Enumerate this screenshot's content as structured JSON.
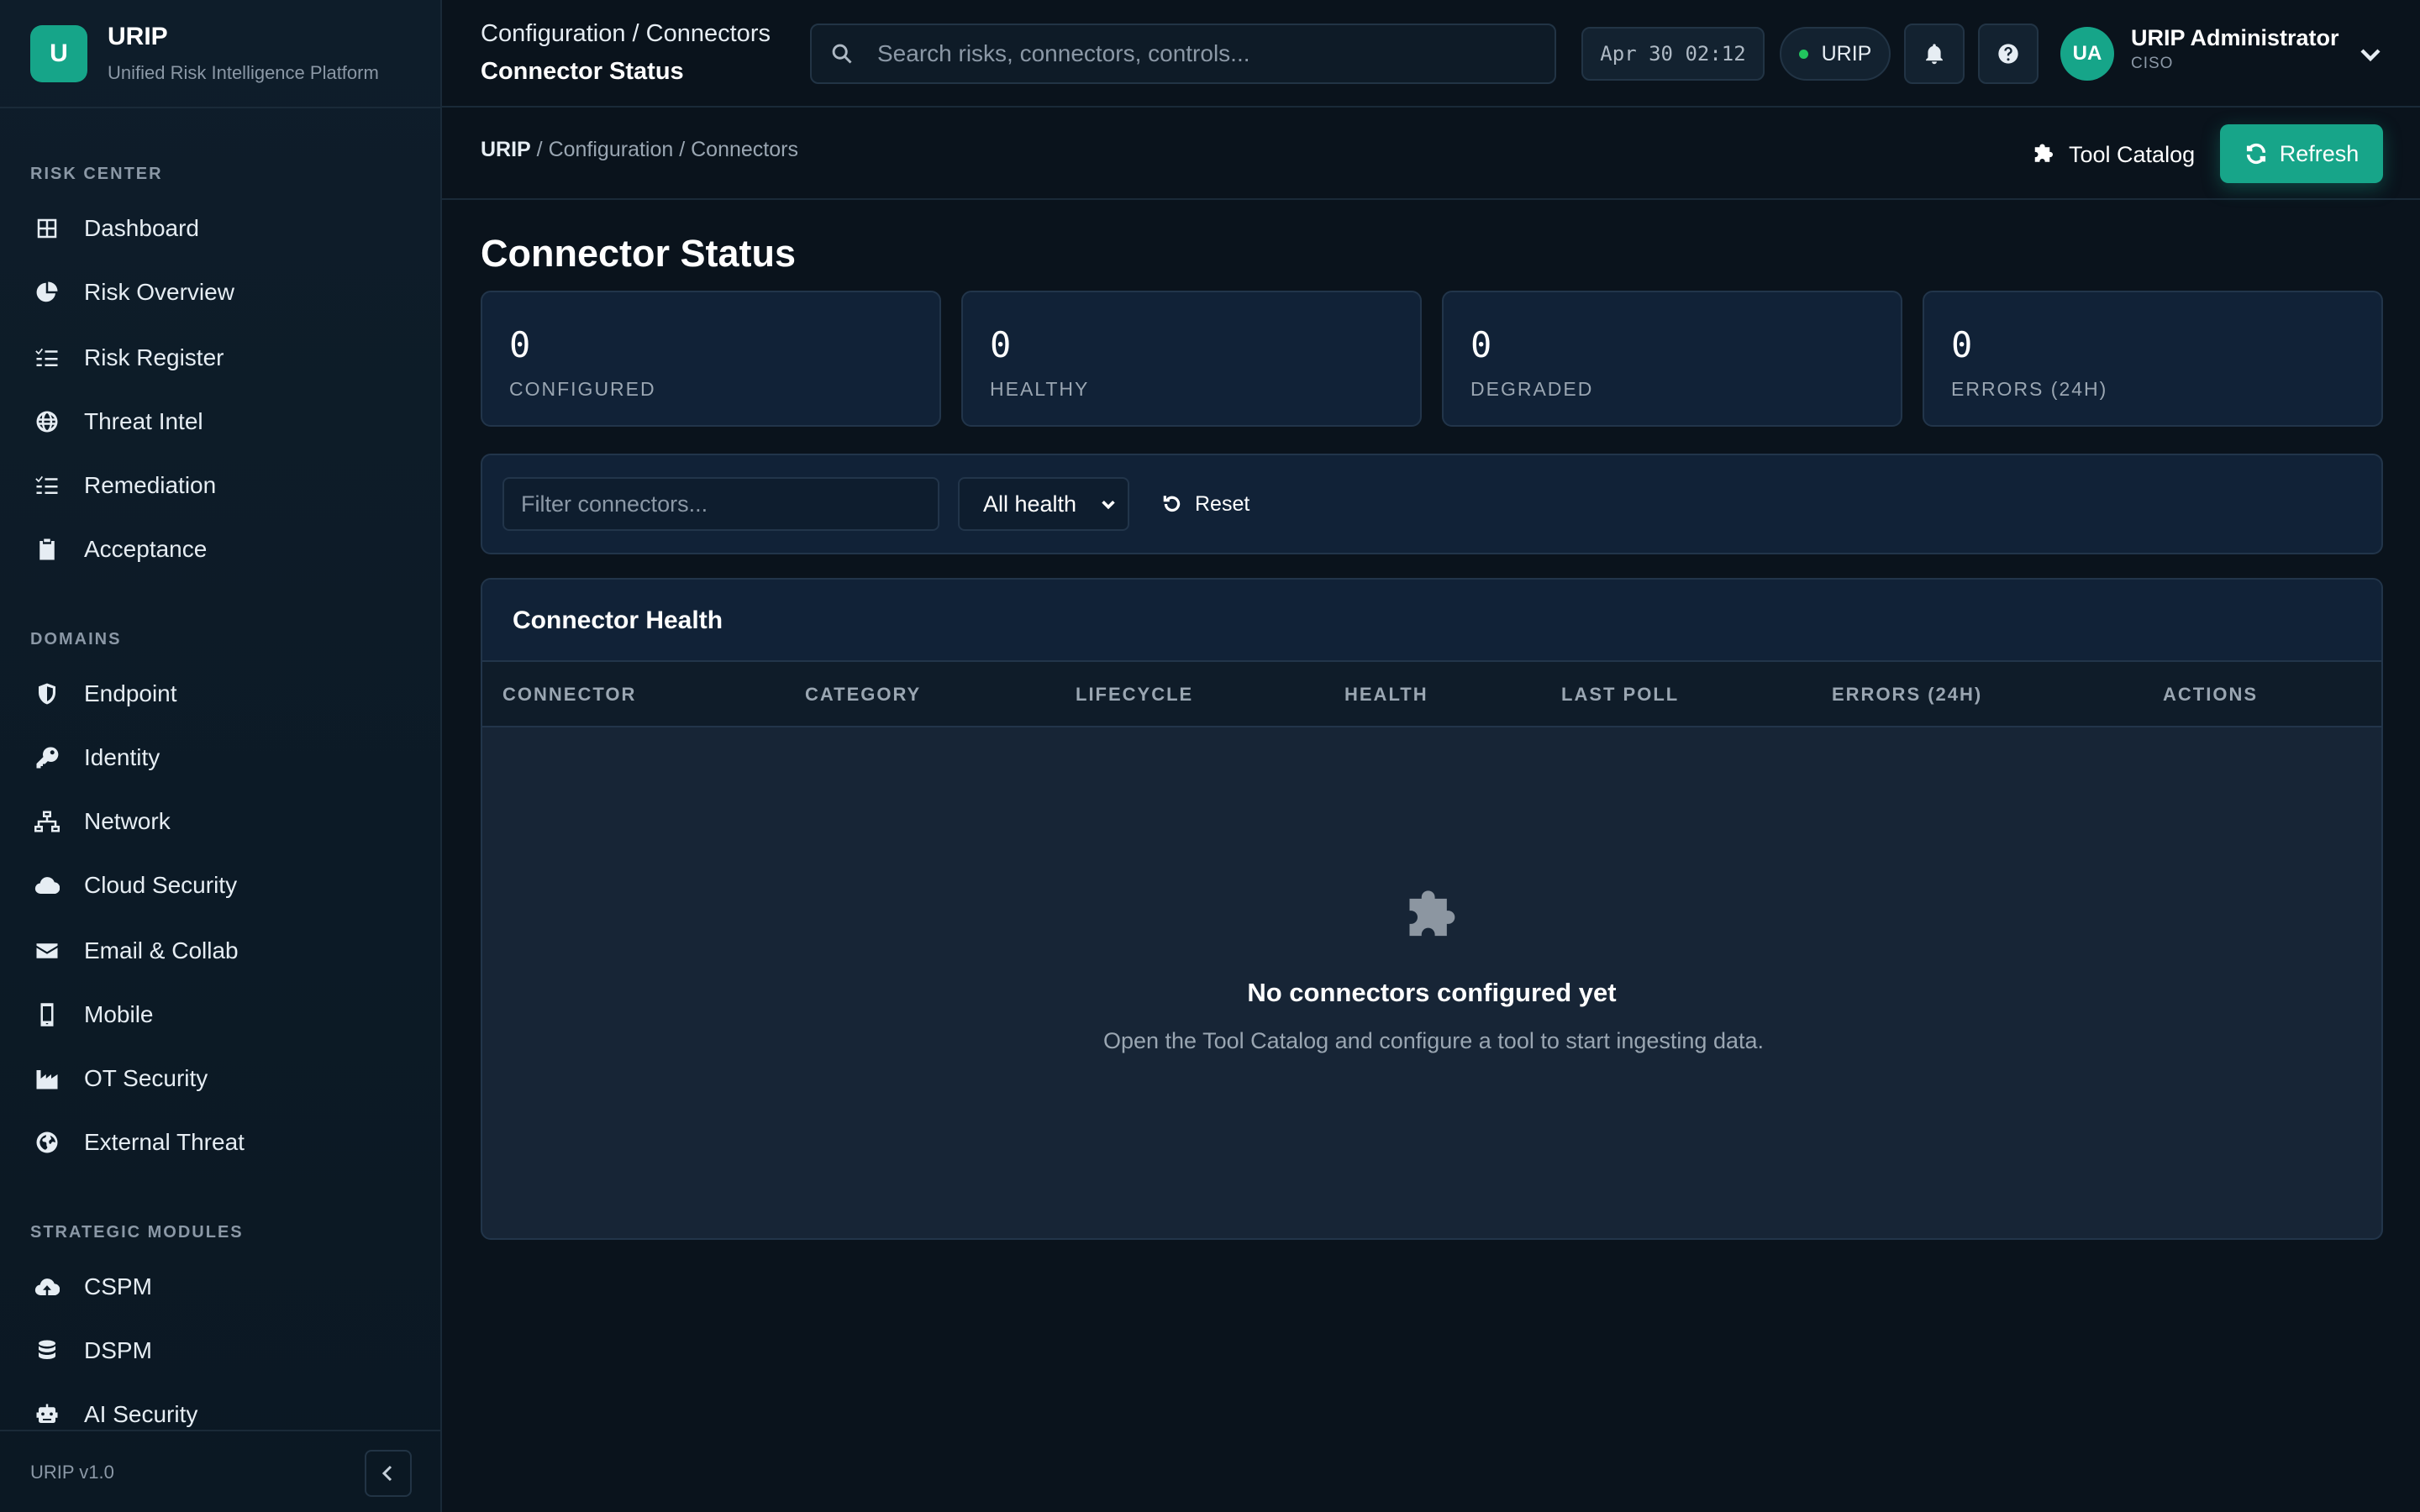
{
  "brand": {
    "logo_letter": "U",
    "name": "URIP",
    "subtitle": "Unified Risk Intelligence Platform"
  },
  "sidebar": {
    "sections": [
      {
        "label": "RISK CENTER",
        "items": [
          {
            "label": "Dashboard",
            "icon": "grid-icon"
          },
          {
            "label": "Risk Overview",
            "icon": "pie-chart-icon"
          },
          {
            "label": "Risk Register",
            "icon": "list-check-icon"
          },
          {
            "label": "Threat Intel",
            "icon": "globe-icon"
          },
          {
            "label": "Remediation",
            "icon": "list-check-icon"
          },
          {
            "label": "Acceptance",
            "icon": "clipboard-check-icon"
          }
        ]
      },
      {
        "label": "DOMAINS",
        "items": [
          {
            "label": "Endpoint",
            "icon": "shield-icon"
          },
          {
            "label": "Identity",
            "icon": "key-icon"
          },
          {
            "label": "Network",
            "icon": "network-icon"
          },
          {
            "label": "Cloud Security",
            "icon": "cloud-icon"
          },
          {
            "label": "Email & Collab",
            "icon": "envelope-icon"
          },
          {
            "label": "Mobile",
            "icon": "mobile-icon"
          },
          {
            "label": "OT Security",
            "icon": "industry-icon"
          },
          {
            "label": "External Threat",
            "icon": "globe-alt-icon"
          }
        ]
      },
      {
        "label": "STRATEGIC MODULES",
        "items": [
          {
            "label": "CSPM",
            "icon": "cloud-upload-icon"
          },
          {
            "label": "DSPM",
            "icon": "database-icon"
          },
          {
            "label": "AI Security",
            "icon": "robot-icon"
          }
        ]
      }
    ],
    "version": "URIP v1.0"
  },
  "topbar": {
    "path": "Configuration / Connectors",
    "page": "Connector Status",
    "search_placeholder": "Search risks, connectors, controls...",
    "clock": "Apr 30 02:12",
    "tenant": "URIP",
    "user": {
      "initials": "UA",
      "name": "URIP Administrator",
      "role": "CISO"
    }
  },
  "subheader": {
    "breadcrumb_root": "URIP",
    "breadcrumb_rest": " / Configuration / Connectors",
    "tool_catalog_label": "Tool Catalog",
    "refresh_label": "Refresh"
  },
  "main": {
    "title": "Connector Status",
    "stats": [
      {
        "value": "0",
        "label": "CONFIGURED"
      },
      {
        "value": "0",
        "label": "HEALTHY"
      },
      {
        "value": "0",
        "label": "DEGRADED"
      },
      {
        "value": "0",
        "label": "ERRORS (24H)"
      }
    ],
    "filters": {
      "search_placeholder": "Filter connectors...",
      "health_value": "All health",
      "reset_label": "Reset"
    },
    "table": {
      "title": "Connector Health",
      "columns": [
        "CONNECTOR",
        "CATEGORY",
        "LIFECYCLE",
        "HEALTH",
        "LAST POLL",
        "ERRORS (24H)",
        "ACTIONS"
      ],
      "empty_title": "No connectors configured yet",
      "empty_message": "Open the Tool Catalog and configure a tool to start ingesting data."
    }
  },
  "colors": {
    "accent": "#17a589",
    "background": "#0a131c",
    "panel": "#112237",
    "status_ok": "#22c55e"
  }
}
